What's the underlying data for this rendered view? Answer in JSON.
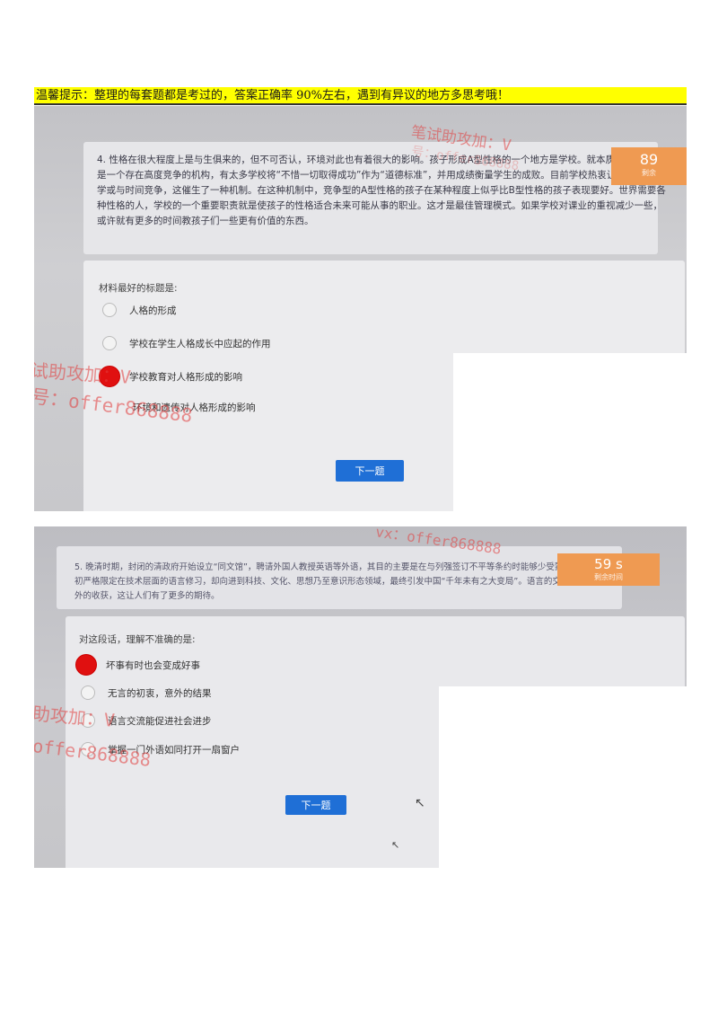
{
  "tip": "温馨提示：整理的每套题都是考过的，答案正确率 90%左右，遇到有异议的地方多思考哦！",
  "q1": {
    "text": "4. 性格在很大程度上是与生俱来的，但不可否认，环境对此也有着很大的影响。孩子形成A型性格的一个地方是学校。就本质而言，学校是一个存在高度竞争的机构，有太多学校将“不惜一切取得成功”作为“道德标准”，并用成绩衡量学生的成败。目前学校热衷让孩子们与同学或与时间竞争，这催生了一种机制。在这种机制中，竞争型的A型性格的孩子在某种程度上似乎比B型性格的孩子表现要好。世界需要各种性格的人，学校的一个重要职责就是使孩子的性格适合未来可能从事的职业。这才是最佳管理模式。如果学校对课业的重视减少一些，或许就有更多的时间教孩子们一些更有价值的东西。",
    "timer": "89",
    "timer_label": "剩余",
    "stem": "材料最好的标题是:",
    "options": [
      "人格的形成",
      "学校在学生人格成长中应起的作用",
      "学校教育对人格形成的影响",
      "环境和遗传对人格形成的影响"
    ],
    "selected": 2,
    "next": "下一题"
  },
  "q2": {
    "text": "5. 晚清时期，封闭的清政府开始设立“同文馆”，聘请外国人教授英语等外语，其目的主要是在与列强签订不平等条约时能够少受蒙骗。但这种最初严格限定在技术层面的语言修习，却向进到科技、文化、思想乃至意识形态领域，最终引发中国“千年未有之大变局”。语言的交流往往会带来意外的收获，这让人们有了更多的期待。",
    "timer": "59 s",
    "timer_label": "剩余时间",
    "stem": "对这段话，理解不准确的是:",
    "options": [
      "坏事有时也会变成好事",
      "无言的初衷，意外的结果",
      "语言交流能促进社会进步",
      "掌握一门外语如同打开一扇窗户"
    ],
    "selected": 0,
    "next": "下一题"
  },
  "watermarks": {
    "a1": "笔试助攻加：V",
    "a2": "号：offer868888",
    "b1": "试助攻加：V",
    "b2": "号：offer868888",
    "c1": "vx：offer868888",
    "d1": "助攻加：V",
    "d2": "offer868888"
  },
  "colors": {
    "tip_bg": "#ffff00",
    "selected": "#e01010",
    "button": "#1f6fd6",
    "timer": "#ef9a52"
  }
}
